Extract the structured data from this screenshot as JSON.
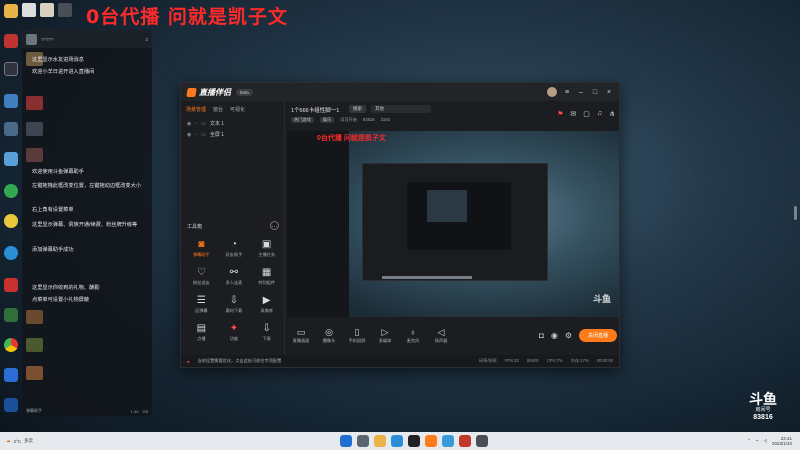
{
  "overlay": {
    "stream_title": "0台代播 问就是凯子文"
  },
  "desktop": {
    "icon_names": [
      "folder-icon",
      "recycle-bin-icon",
      "game-icon",
      "dota-icon",
      "qq-icon",
      "edge-icon",
      "chrome-icon",
      "app-icon",
      "tool-icon",
      "settings-icon"
    ]
  },
  "chat": {
    "header_name": "?????",
    "header_count": "2",
    "messages": [
      "这里显示水友进场消息",
      "欢迎小羊日进开进入直播间",
      "欢迎使用斗鱼弹幕助手",
      "左键拖拽此框改变位置，左键拖动边框改变大小",
      "右上角有设置菜单",
      "这里显示弹幕、贵族开通/续费、粉丝牌升级等",
      "添加弹幕助手成功",
      "这里显示你收到的礼物、酬勤",
      "点菜单可设置小礼物屏蔽"
    ],
    "footer": {
      "label": "弹幕助手",
      "rate": "1.40",
      "count": "2/5"
    }
  },
  "app": {
    "name": "直播伴侣",
    "version": "beta",
    "left_tabs": [
      "场景管理",
      "窗台",
      "可视化"
    ],
    "scenes": [
      {
        "name": "文本 1"
      },
      {
        "name": "全屏 1"
      }
    ],
    "tools_heading": "工具箱",
    "tools": [
      {
        "label": "弹幕助手",
        "icon": "chat-bubble-icon",
        "active": true
      },
      {
        "label": "好友助手",
        "icon": "user-icon",
        "active": false
      },
      {
        "label": "主播任务",
        "icon": "clipboard-icon",
        "active": false
      },
      {
        "label": "粉丝送友",
        "icon": "heart-hand-icon",
        "active": false
      },
      {
        "label": "多人连麦",
        "icon": "link-icon",
        "active": false
      },
      {
        "label": "特别组件",
        "icon": "grid-icon",
        "active": false
      },
      {
        "label": "远弹幕",
        "icon": "text-icon",
        "active": false
      },
      {
        "label": "素材下载",
        "icon": "download-icon",
        "active": false
      },
      {
        "label": "录像库",
        "icon": "video-icon",
        "active": false
      },
      {
        "label": "点播",
        "icon": "book-icon",
        "active": false
      },
      {
        "label": "功能",
        "icon": "new-icon",
        "active": false
      },
      {
        "label": "下载",
        "icon": "download-icon",
        "active": false
      }
    ],
    "room": {
      "title": "1个666卡组性脚一1",
      "tag": "搜索",
      "category": "其他",
      "stats": [
        "热门游戏",
        "娱乐",
        "试可开始",
        "83816",
        "3192"
      ]
    },
    "preview": {
      "title": "0台代播 问就是凯子文",
      "watermark": "斗鱼"
    },
    "controls": [
      {
        "label": "直播画面",
        "icon": "monitor-icon"
      },
      {
        "label": "摄像头",
        "icon": "camera-icon"
      },
      {
        "label": "手机投屏",
        "icon": "phone-icon"
      },
      {
        "label": "多媒体",
        "icon": "media-icon"
      },
      {
        "label": "麦克风",
        "icon": "microphone-icon"
      },
      {
        "label": "扬声器",
        "icon": "speaker-icon"
      }
    ],
    "live_button": "关闭直播",
    "status": {
      "notice": "当前设置需要优化，点击此处可前往专项配置",
      "items": [
        "码率/帧率",
        "FPS:30",
        "0KB/S",
        "CPU:7%",
        "内存:17%",
        "00:00:00"
      ]
    }
  },
  "brand": {
    "logo": "斗鱼",
    "room_label": "房间号",
    "room_number": "83816"
  },
  "taskbar": {
    "weather": "2°C",
    "weather_desc": "多云",
    "time": "22:41",
    "date": "2023/1/10"
  }
}
